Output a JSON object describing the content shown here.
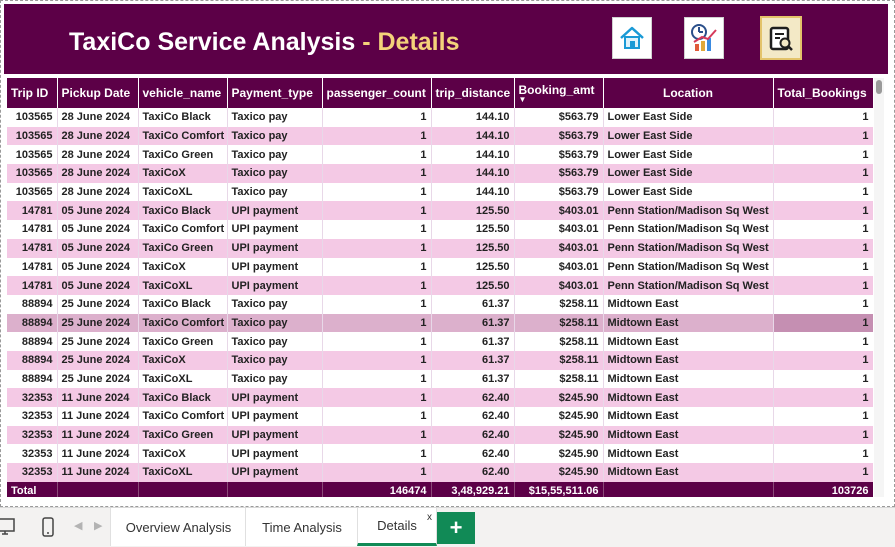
{
  "header": {
    "title_main": "TaxiCo Service Analysis",
    "title_sep": " - ",
    "title_accent": "Details",
    "colors": {
      "background": "#5c0047",
      "accent": "#f4d27a"
    },
    "nav_buttons": [
      {
        "name": "home-icon"
      },
      {
        "name": "time-chart-icon"
      },
      {
        "name": "report-search-icon"
      }
    ]
  },
  "table": {
    "columns": [
      "Trip ID",
      "Pickup Date",
      "vehicle_name",
      "Payment_type",
      "passenger_count",
      "trip_distance",
      "Booking_amt",
      "Location",
      "Total_Bookings"
    ],
    "sort_column": "Booking_amt",
    "rows": [
      [
        "103565",
        "28 June 2024",
        "TaxiCo Black",
        "Taxico pay",
        "1",
        "144.10",
        "$563.79",
        "Lower East Side",
        "1"
      ],
      [
        "103565",
        "28 June 2024",
        "TaxiCo Comfort",
        "Taxico pay",
        "1",
        "144.10",
        "$563.79",
        "Lower East Side",
        "1"
      ],
      [
        "103565",
        "28 June 2024",
        "TaxiCo Green",
        "Taxico pay",
        "1",
        "144.10",
        "$563.79",
        "Lower East Side",
        "1"
      ],
      [
        "103565",
        "28 June 2024",
        "TaxiCoX",
        "Taxico pay",
        "1",
        "144.10",
        "$563.79",
        "Lower East Side",
        "1"
      ],
      [
        "103565",
        "28 June 2024",
        "TaxiCoXL",
        "Taxico pay",
        "1",
        "144.10",
        "$563.79",
        "Lower East Side",
        "1"
      ],
      [
        "14781",
        "05 June 2024",
        "TaxiCo Black",
        "UPI payment",
        "1",
        "125.50",
        "$403.01",
        "Penn Station/Madison Sq West",
        "1"
      ],
      [
        "14781",
        "05 June 2024",
        "TaxiCo Comfort",
        "UPI payment",
        "1",
        "125.50",
        "$403.01",
        "Penn Station/Madison Sq West",
        "1"
      ],
      [
        "14781",
        "05 June 2024",
        "TaxiCo Green",
        "UPI payment",
        "1",
        "125.50",
        "$403.01",
        "Penn Station/Madison Sq West",
        "1"
      ],
      [
        "14781",
        "05 June 2024",
        "TaxiCoX",
        "UPI payment",
        "1",
        "125.50",
        "$403.01",
        "Penn Station/Madison Sq West",
        "1"
      ],
      [
        "14781",
        "05 June 2024",
        "TaxiCoXL",
        "UPI payment",
        "1",
        "125.50",
        "$403.01",
        "Penn Station/Madison Sq West",
        "1"
      ],
      [
        "88894",
        "25 June 2024",
        "TaxiCo Black",
        "Taxico pay",
        "1",
        "61.37",
        "$258.11",
        "Midtown East",
        "1"
      ],
      [
        "88894",
        "25 June 2024",
        "TaxiCo Comfort",
        "Taxico pay",
        "1",
        "61.37",
        "$258.11",
        "Midtown East",
        "1"
      ],
      [
        "88894",
        "25 June 2024",
        "TaxiCo Green",
        "Taxico pay",
        "1",
        "61.37",
        "$258.11",
        "Midtown East",
        "1"
      ],
      [
        "88894",
        "25 June 2024",
        "TaxiCoX",
        "Taxico pay",
        "1",
        "61.37",
        "$258.11",
        "Midtown East",
        "1"
      ],
      [
        "88894",
        "25 June 2024",
        "TaxiCoXL",
        "Taxico pay",
        "1",
        "61.37",
        "$258.11",
        "Midtown East",
        "1"
      ],
      [
        "32353",
        "11 June 2024",
        "TaxiCo Black",
        "UPI payment",
        "1",
        "62.40",
        "$245.90",
        "Midtown East",
        "1"
      ],
      [
        "32353",
        "11 June 2024",
        "TaxiCo Comfort",
        "UPI payment",
        "1",
        "62.40",
        "$245.90",
        "Midtown East",
        "1"
      ],
      [
        "32353",
        "11 June 2024",
        "TaxiCo Green",
        "UPI payment",
        "1",
        "62.40",
        "$245.90",
        "Midtown East",
        "1"
      ],
      [
        "32353",
        "11 June 2024",
        "TaxiCoX",
        "UPI payment",
        "1",
        "62.40",
        "$245.90",
        "Midtown East",
        "1"
      ],
      [
        "32353",
        "11 June 2024",
        "TaxiCoXL",
        "UPI payment",
        "1",
        "62.40",
        "$245.90",
        "Midtown East",
        "1"
      ]
    ],
    "highlighted_row": 11,
    "total": {
      "label": "Total",
      "passenger_count": "146474",
      "trip_distance": "3,48,929.21",
      "booking_amt": "$15,55,511.06",
      "total_bookings": "103726"
    }
  },
  "tabs": {
    "items": [
      "Overview Analysis",
      "Time Analysis",
      "Details"
    ],
    "active": "Details",
    "close_glyph": "x",
    "add_glyph": "+"
  }
}
